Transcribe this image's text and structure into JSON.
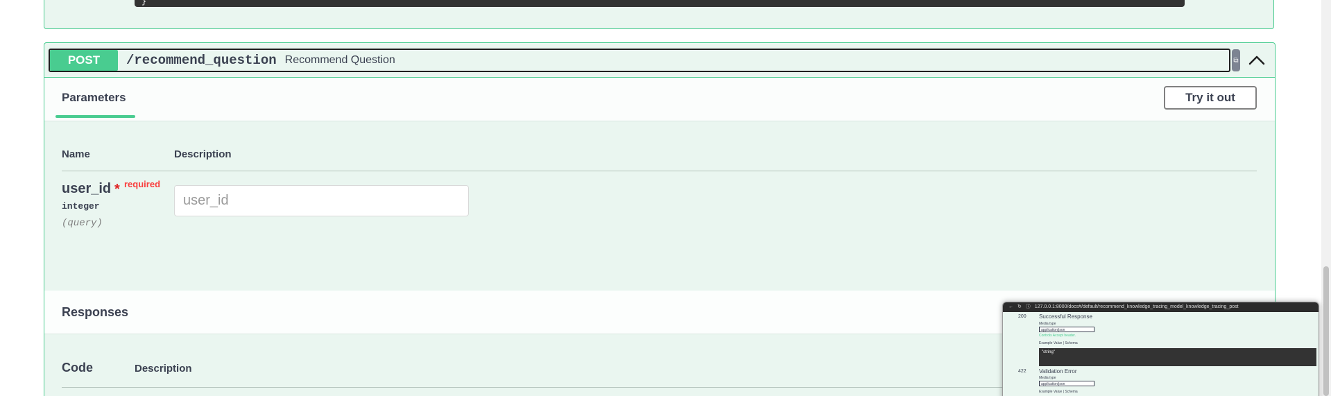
{
  "previous_block": {
    "code_tail": "}"
  },
  "operation": {
    "method": "POST",
    "path": "/recommend_question",
    "summary": "Recommend Question"
  },
  "tabs": {
    "parameters_label": "Parameters",
    "try_button_label": "Try it out"
  },
  "parameters_table": {
    "name_header": "Name",
    "description_header": "Description",
    "rows": [
      {
        "name": "user_id",
        "required_star": "*",
        "required_label": "required",
        "type": "integer",
        "location": "(query)",
        "input_placeholder": "user_id"
      }
    ]
  },
  "responses": {
    "title": "Responses",
    "code_header": "Code",
    "description_header": "Description"
  },
  "thumbnail": {
    "url_text": "127.0.0.1:8000/docs#/default/recommend_knowledge_tracing_model_knowledge_tracing_post",
    "codes": [
      "200",
      "422"
    ],
    "successful_response": "Successful Response",
    "validation_error": "Validation Error",
    "media_type_label": "Media type",
    "media_type_value": "application/json",
    "controls_accept": "Controls Accept header.",
    "example_label": "Example Value | Schema",
    "example_value": "\"string\""
  },
  "colors": {
    "post_green": "#49cc90",
    "block_bg": "#eaf6f0",
    "text": "#3b4151",
    "required_red": "#f93e3e"
  }
}
